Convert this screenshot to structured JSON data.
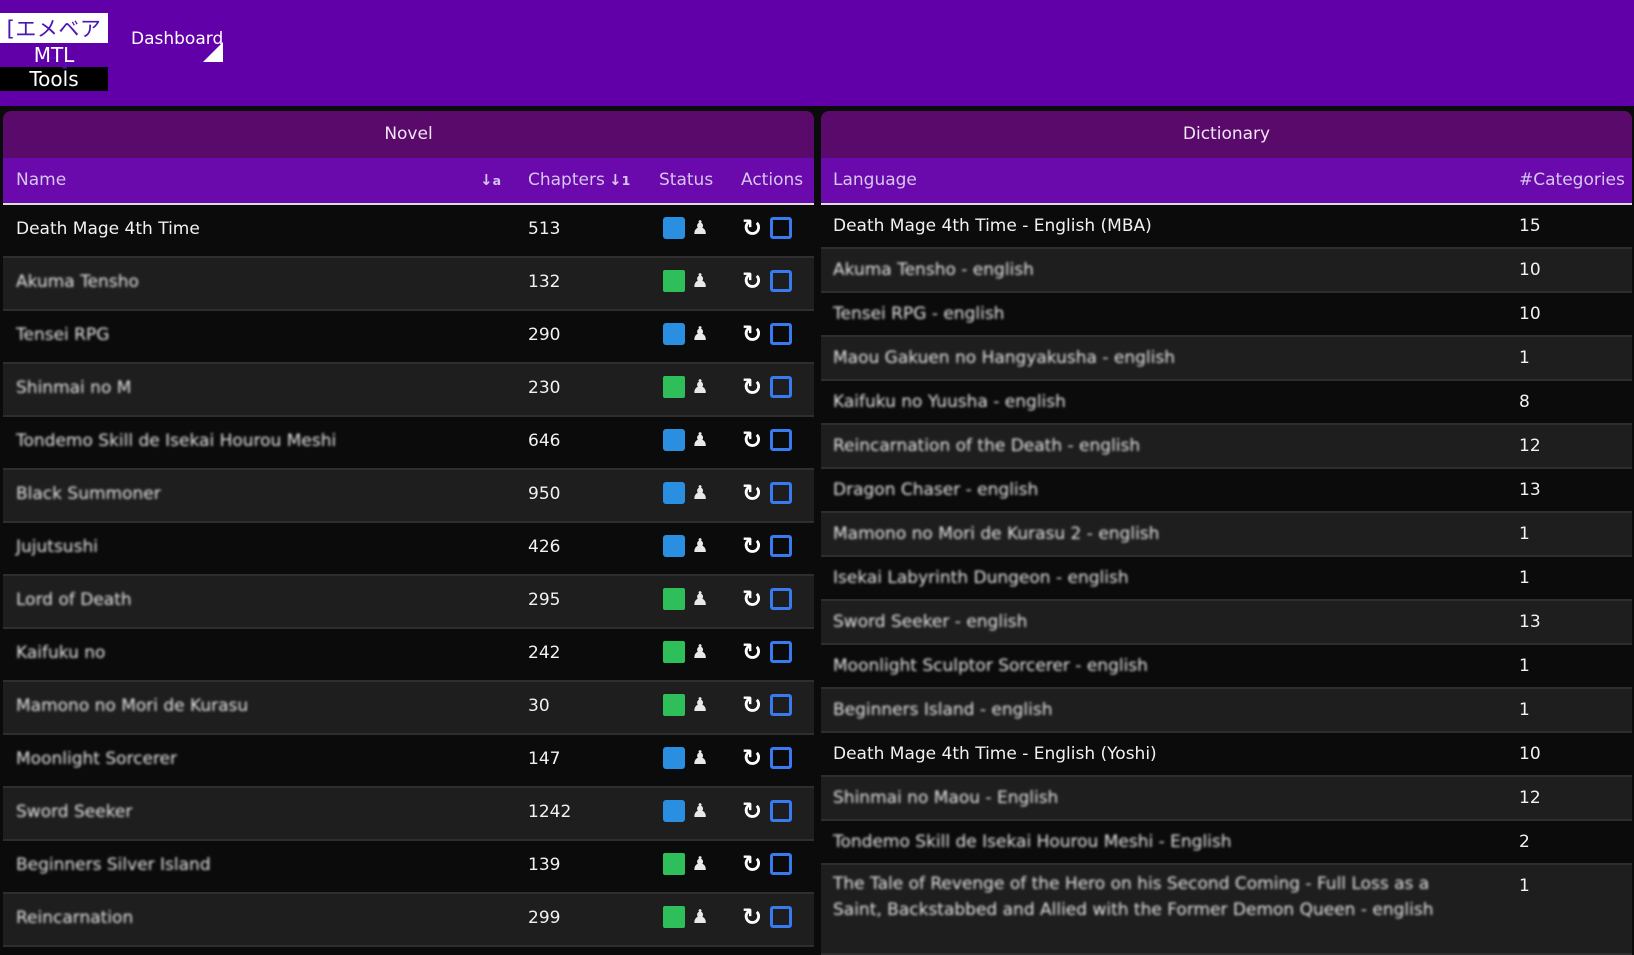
{
  "header": {
    "logo_line1": "[エメベアー]",
    "logo_line2": "MTL",
    "logo_line3": "Tools",
    "nav_dashboard": "Dashboard"
  },
  "novel": {
    "title": "Novel",
    "columns": {
      "name": "Name",
      "chapters": "Chapters",
      "status": "Status",
      "actions": "Actions"
    },
    "rows": [
      {
        "name": "Death Mage 4th Time",
        "chapters": "513",
        "status": "blue",
        "blurred": false
      },
      {
        "name": "Akuma Tensho",
        "chapters": "132",
        "status": "green",
        "blurred": true
      },
      {
        "name": "Tensei RPG",
        "chapters": "290",
        "status": "blue",
        "blurred": true
      },
      {
        "name": "Shinmai no M",
        "chapters": "230",
        "status": "green",
        "blurred": true
      },
      {
        "name": "Tondemo Skill de Isekai Hourou Meshi",
        "chapters": "646",
        "status": "blue",
        "blurred": true
      },
      {
        "name": "Black Summoner",
        "chapters": "950",
        "status": "blue",
        "blurred": true
      },
      {
        "name": "Jujutsushi",
        "chapters": "426",
        "status": "blue",
        "blurred": true
      },
      {
        "name": "Lord of Death",
        "chapters": "295",
        "status": "green",
        "blurred": true
      },
      {
        "name": "Kaifuku no",
        "chapters": "242",
        "status": "green",
        "blurred": true
      },
      {
        "name": "Mamono no Mori de Kurasu",
        "chapters": "30",
        "status": "green",
        "blurred": true
      },
      {
        "name": "Moonlight Sorcerer",
        "chapters": "147",
        "status": "blue",
        "blurred": true
      },
      {
        "name": "Sword Seeker",
        "chapters": "1242",
        "status": "blue",
        "blurred": true
      },
      {
        "name": "Beginners Silver Island",
        "chapters": "139",
        "status": "green",
        "blurred": true
      },
      {
        "name": "Reincarnation",
        "chapters": "299",
        "status": "green",
        "blurred": true
      }
    ]
  },
  "dictionary": {
    "title": "Dictionary",
    "columns": {
      "language": "Language",
      "categories": "#Categories"
    },
    "rows": [
      {
        "language": "Death Mage 4th Time - English (MBA)",
        "count": "15",
        "blurred": false
      },
      {
        "language": "Akuma Tensho - english",
        "count": "10",
        "blurred": true
      },
      {
        "language": "Tensei RPG - english",
        "count": "10",
        "blurred": true
      },
      {
        "language": "Maou Gakuen no Hangyakusha - english",
        "count": "1",
        "blurred": true
      },
      {
        "language": "Kaifuku no Yuusha - english",
        "count": "8",
        "blurred": true
      },
      {
        "language": "Reincarnation of the Death - english",
        "count": "12",
        "blurred": true
      },
      {
        "language": "Dragon Chaser - english",
        "count": "13",
        "blurred": true
      },
      {
        "language": "Mamono no Mori de Kurasu 2 - english",
        "count": "1",
        "blurred": true
      },
      {
        "language": "Isekai Labyrinth Dungeon - english",
        "count": "1",
        "blurred": true
      },
      {
        "language": "Sword Seeker - english",
        "count": "13",
        "blurred": true
      },
      {
        "language": "Moonlight Sculptor Sorcerer - english",
        "count": "1",
        "blurred": true
      },
      {
        "language": "Beginners Island - english",
        "count": "1",
        "blurred": true
      },
      {
        "language": "Death Mage 4th Time - English (Yoshi)",
        "count": "10",
        "blurred": false
      },
      {
        "language": "Shinmai no Maou - English",
        "count": "12",
        "blurred": true
      },
      {
        "language": "Tondemo Skill de Isekai Hourou Meshi - English",
        "count": "2",
        "blurred": true
      },
      {
        "language": "The Tale of Revenge of the Hero on his Second Coming - Full Loss as a Saint, Backstabbed and Allied with the Former Demon Queen - english",
        "count": "1",
        "blurred": true
      }
    ]
  },
  "colors": {
    "topbar": "#6100a8",
    "panel_header": "#5a0a6a",
    "table_header": "#6a0aad",
    "mail_green": "#2fbf5a",
    "mail_blue": "#2a8fe0",
    "edit_blue": "#3a7af0"
  },
  "icons": {
    "status_mail": "envelope-icon",
    "status_open_mail": "envelope-open-icon",
    "status_spy": "user-secret-icon",
    "action_refresh": "refresh-icon",
    "action_edit": "edit-icon",
    "sort": "sort-icon"
  }
}
